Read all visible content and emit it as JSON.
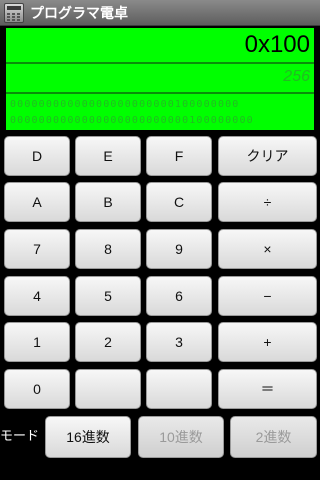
{
  "window": {
    "title": "プログラマ電卓",
    "icon": "calculator-icon"
  },
  "display": {
    "hex": "0x100",
    "dec": "256",
    "bin_line_1": "00000000000000000000000100000000",
    "bin_line_2": "0000000000000000000000000100000000",
    "colors": {
      "background": "#00ff00",
      "text": "#000000",
      "faded_text": "#22bb22"
    }
  },
  "keys": {
    "d": "D",
    "e": "E",
    "f": "F",
    "clear": "クリア",
    "a": "A",
    "b": "B",
    "c": "C",
    "divide": "÷",
    "seven": "7",
    "eight": "8",
    "nine": "9",
    "multiply": "×",
    "four": "4",
    "five": "5",
    "six": "6",
    "minus": "−",
    "one": "1",
    "two": "2",
    "three": "3",
    "plus": "+",
    "zero": "0",
    "blank1": "",
    "blank2": "",
    "equals": "＝"
  },
  "mode": {
    "label": "モード",
    "hex": "16進数",
    "dec": "10進数",
    "bin": "2進数",
    "selected": "16進数"
  }
}
